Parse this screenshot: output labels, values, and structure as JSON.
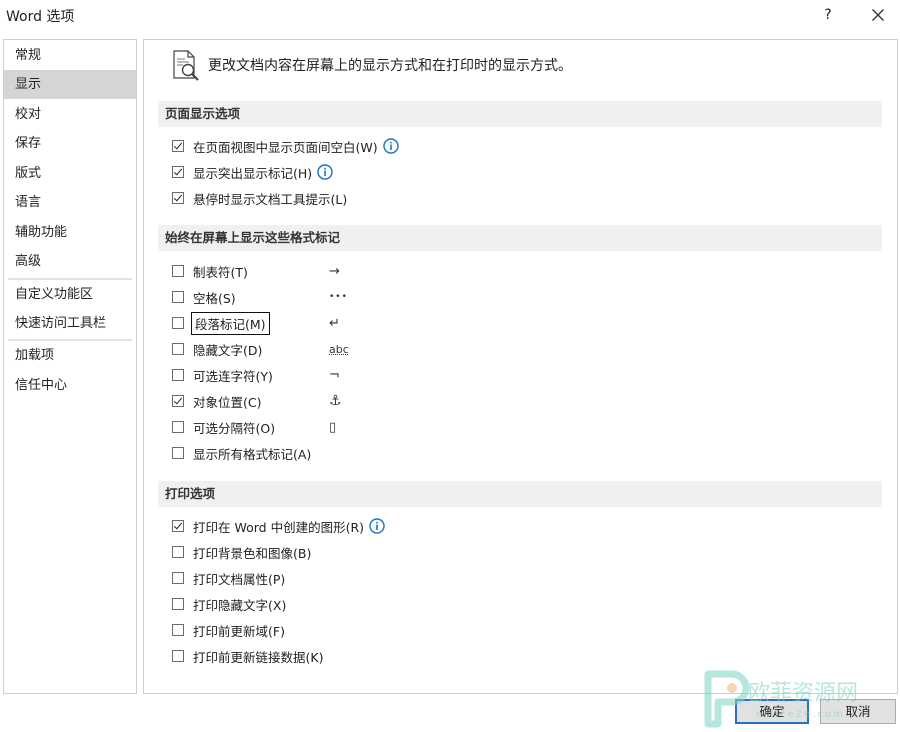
{
  "window": {
    "title": "Word 选项",
    "help_label": "?"
  },
  "sidebar": {
    "items": [
      {
        "label": "常规"
      },
      {
        "label": "显示",
        "selected": true
      },
      {
        "label": "校对"
      },
      {
        "label": "保存"
      },
      {
        "label": "版式"
      },
      {
        "label": "语言"
      },
      {
        "label": "辅助功能"
      },
      {
        "label": "高级"
      },
      {
        "label": "自定义功能区"
      },
      {
        "label": "快速访问工具栏"
      },
      {
        "label": "加载项"
      },
      {
        "label": "信任中心"
      }
    ]
  },
  "main": {
    "header": "更改文档内容在屏幕上的显示方式和在打印时的显示方式。",
    "page_display": {
      "title": "页面显示选项",
      "options": [
        {
          "label": "在页面视图中显示页面间空白(W)",
          "checked": true,
          "info": true
        },
        {
          "label": "显示突出显示标记(H)",
          "checked": true,
          "info": true
        },
        {
          "label": "悬停时显示文档工具提示(L)",
          "checked": true
        }
      ]
    },
    "format_marks": {
      "title": "始终在屏幕上显示这些格式标记",
      "options": [
        {
          "label": "制表符(T)",
          "checked": false,
          "mark": "→"
        },
        {
          "label": "空格(S)",
          "checked": false,
          "mark": "•••"
        },
        {
          "label": "段落标记(M)",
          "checked": false,
          "mark": "↵",
          "focused": true
        },
        {
          "label": "隐藏文字(D)",
          "checked": false,
          "mark": "abc"
        },
        {
          "label": "可选连字符(Y)",
          "checked": false,
          "mark": "¬"
        },
        {
          "label": "对象位置(C)",
          "checked": true,
          "mark": "⚓"
        },
        {
          "label": "可选分隔符(O)",
          "checked": false,
          "mark": "▯"
        },
        {
          "label": "显示所有格式标记(A)",
          "checked": false
        }
      ]
    },
    "print": {
      "title": "打印选项",
      "options": [
        {
          "label": "打印在 Word 中创建的图形(R)",
          "checked": true,
          "info": true
        },
        {
          "label": "打印背景色和图像(B)",
          "checked": false
        },
        {
          "label": "打印文档属性(P)",
          "checked": false
        },
        {
          "label": "打印隐藏文字(X)",
          "checked": false
        },
        {
          "label": "打印前更新域(F)",
          "checked": false
        },
        {
          "label": "打印前更新链接数据(K)",
          "checked": false
        }
      ]
    }
  },
  "footer": {
    "ok_label": "确定",
    "cancel_label": "取消"
  },
  "watermark": {
    "brand": "欧菲资源网",
    "url": "office26.com"
  },
  "colors": {
    "accent": "#2d6fbf",
    "info_icon": "#1a73c7",
    "selected_bg": "#d5d5d5",
    "section_bg": "#f0f0f0",
    "watermark": "#7dd3c0"
  }
}
